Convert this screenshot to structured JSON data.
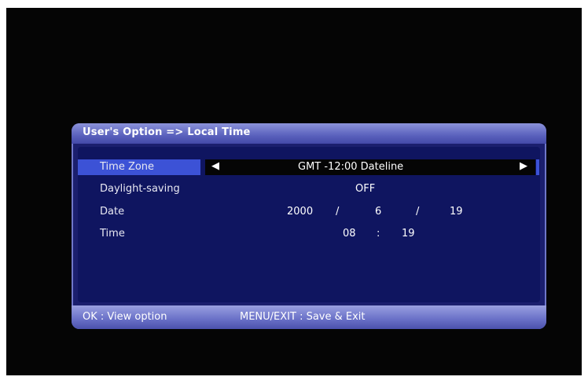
{
  "dialog": {
    "title": "User's Option => Local Time",
    "rows": [
      {
        "label": "Time Zone",
        "value": "GMT -12:00 Dateline"
      },
      {
        "label": "Daylight-saving",
        "value": "OFF"
      },
      {
        "label": "Date",
        "year": "2000",
        "sep1": "/",
        "month": "6",
        "sep2": "/",
        "day": "19"
      },
      {
        "label": "Time",
        "hour": "08",
        "sep": ":",
        "minute": "19"
      }
    ],
    "arrows": {
      "left": "◀",
      "right": "▶"
    }
  },
  "footer": {
    "hint_ok": "OK : View option",
    "hint_menu": "MENU/EXIT : Save & Exit"
  },
  "colors": {
    "selected_label_bg": "#3c52d6",
    "panel_bg": "#0f1560",
    "title_bar": "#5a61bd"
  }
}
